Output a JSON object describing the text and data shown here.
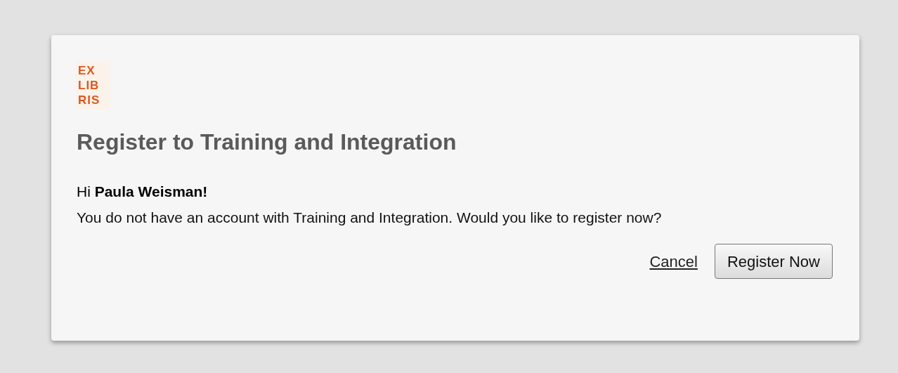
{
  "logo": {
    "lines": [
      "EX",
      "LIB",
      "RIS"
    ]
  },
  "dialog": {
    "title": "Register to Training and Integration",
    "greeting": "Hi **Paula Weisman!**",
    "message": "You do not have an account with Training and Integration. Would you like to register now?"
  },
  "buttons": [
    {
      "kind": "link",
      "label": "Cancel"
    },
    {
      "kind": "button",
      "label": "Register Now"
    }
  ]
}
